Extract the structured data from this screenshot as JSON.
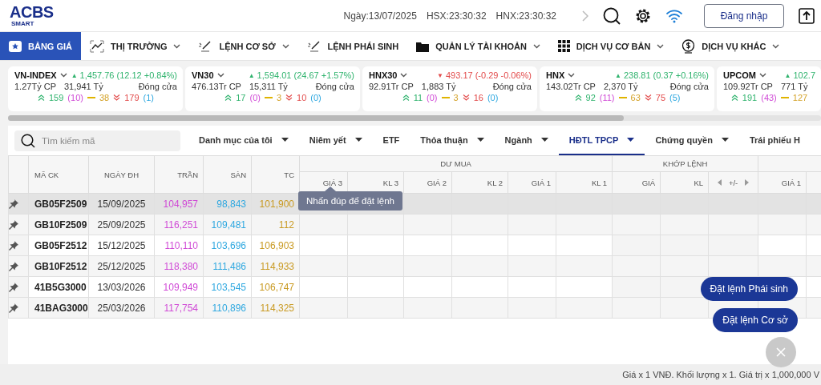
{
  "header": {
    "logo": {
      "name": "ACBS",
      "tagline": "SMART"
    },
    "date": "Ngày:13/07/2025",
    "hsx_time": "HSX:23:30:32",
    "hnx_time": "HNX:23:30:32",
    "login_button": "Đăng nhập"
  },
  "nav": [
    {
      "label": "BẢNG GIÁ",
      "selected": true,
      "has_menu": false
    },
    {
      "label": "THỊ TRƯỜNG",
      "selected": false,
      "has_menu": true
    },
    {
      "label": "LỆNH CƠ SỞ",
      "selected": false,
      "has_menu": true
    },
    {
      "label": "LỆNH PHÁI SINH",
      "selected": false,
      "has_menu": false
    },
    {
      "label": "QUẢN LÝ TÀI KHOẢN",
      "selected": false,
      "has_menu": true
    },
    {
      "label": "DỊCH VỤ CƠ BẢN",
      "selected": false,
      "has_menu": true
    },
    {
      "label": "DỊCH VỤ KHÁC",
      "selected": false,
      "has_menu": true
    }
  ],
  "indices": [
    {
      "name": "VN-INDEX",
      "arrow": "▲",
      "color": "#2fb36d",
      "change": "1,457.76 (12.12 +0.84%)",
      "volume": "1.27Tỷ CP",
      "value": "31,941 Tỷ",
      "status": "Đóng cửa",
      "advances": "159",
      "ceiling": "(10)",
      "unchanged": "38",
      "declines": "179",
      "floor": "(1)"
    },
    {
      "name": "VN30",
      "arrow": "▲",
      "color": "#2fb36d",
      "change": "1,594.01 (24.67 +1.57%)",
      "volume": "476.13Tr CP",
      "value": "15,311 Tỷ",
      "status": "Đóng cửa",
      "advances": "17",
      "ceiling": "(0)",
      "unchanged": "3",
      "declines": "10",
      "floor": "(0)"
    },
    {
      "name": "HNX30",
      "arrow": "▼",
      "color": "#e24a4a",
      "change": "493.17 (-0.29 -0.06%)",
      "volume": "92.91Tr CP",
      "value": "1,883 Tỷ",
      "status": "Đóng cửa",
      "advances": "11",
      "ceiling": "(0)",
      "unchanged": "3",
      "declines": "16",
      "floor": "(0)"
    },
    {
      "name": "HNX",
      "arrow": "▲",
      "color": "#2fb36d",
      "change": "238.81 (0.37 +0.16%)",
      "volume": "143.02Tr CP",
      "value": "2,370 Tỷ",
      "status": "Đóng cửa",
      "advances": "92",
      "ceiling": "(11)",
      "unchanged": "63",
      "declines": "75",
      "floor": "(5)"
    },
    {
      "name": "UPCOM",
      "arrow": "▲",
      "color": "#2fb36d",
      "change": "102.7",
      "volume": "109.92Tr CP",
      "value": "771 Tỷ",
      "advances": "191",
      "ceiling": "(43)",
      "unchanged": "127"
    }
  ],
  "filter": {
    "search": {
      "placeholder": "Tìm kiếm mã"
    },
    "tabs": [
      {
        "label": "Danh mục của tôi",
        "selected": false,
        "has_menu": true
      },
      {
        "label": "Niêm yết",
        "selected": false,
        "has_menu": true
      },
      {
        "label": "ETF",
        "selected": false,
        "has_menu": false
      },
      {
        "label": "Thỏa thuận",
        "selected": false,
        "has_menu": true
      },
      {
        "label": "Ngành",
        "selected": false,
        "has_menu": true
      },
      {
        "label": "HĐTL TPCP",
        "selected": true,
        "has_menu": true
      },
      {
        "label": "Chứng quyền",
        "selected": false,
        "has_menu": true
      },
      {
        "label": "Trái phiếu H",
        "selected": false,
        "has_menu": false
      }
    ]
  },
  "board": {
    "fixed_columns": [
      "MÃ CK",
      "NGÀY ĐH",
      "TRẦN",
      "SÀN",
      "TC"
    ],
    "groups": [
      {
        "label": "DƯ MUA",
        "columns": [
          {
            "label": "GIÁ 3",
            "kind": "plain"
          },
          {
            "label": "KL 3",
            "kind": "plain"
          },
          {
            "label": "GIÁ 2",
            "kind": "plain"
          },
          {
            "label": "KL 2",
            "kind": "plain"
          },
          {
            "label": "GIÁ 1",
            "kind": "plain"
          },
          {
            "label": "KL 1",
            "kind": "plain"
          }
        ]
      },
      {
        "label": "KHỚP LỆNH",
        "columns": [
          {
            "label": "GIÁ",
            "kind": "plain"
          },
          {
            "label": "KL",
            "kind": "plain"
          },
          {
            "label": "+/-",
            "kind": "toggle"
          }
        ]
      },
      {
        "columns": [
          {
            "label": "GIÁ 1",
            "kind": "plain"
          }
        ]
      }
    ],
    "rows": [
      {
        "symbol": "GB05F2509",
        "maturity": "15/09/2025",
        "ceiling": "104,957",
        "floor": "98,843",
        "reference": "101,900",
        "selected": true
      },
      {
        "symbol": "GB10F2509",
        "maturity": "25/09/2025",
        "ceiling": "116,251",
        "floor": "109,481",
        "reference": "112",
        "selected": false
      },
      {
        "symbol": "GB05F2512",
        "maturity": "15/12/2025",
        "ceiling": "110,110",
        "floor": "103,696",
        "reference": "106,903",
        "selected": false
      },
      {
        "symbol": "GB10F2512",
        "maturity": "25/12/2025",
        "ceiling": "118,380",
        "floor": "111,486",
        "reference": "114,933",
        "selected": false
      },
      {
        "symbol": "41B5G3000",
        "maturity": "13/03/2026",
        "ceiling": "109,949",
        "floor": "103,545",
        "reference": "106,747",
        "selected": false
      },
      {
        "symbol": "41BAG3000",
        "maturity": "25/03/2026",
        "ceiling": "117,754",
        "floor": "110,896",
        "reference": "114,325",
        "selected": false
      }
    ],
    "tooltip": "Nhấn đúp để đặt lệnh"
  },
  "order_buttons": [
    "Đặt lệnh Phái sinh",
    "Đặt lệnh Cơ sở"
  ],
  "footer": {
    "note": "Giá x 1 VNĐ. Khối lượng x 1. Giá trị x 1,000,000 V"
  }
}
